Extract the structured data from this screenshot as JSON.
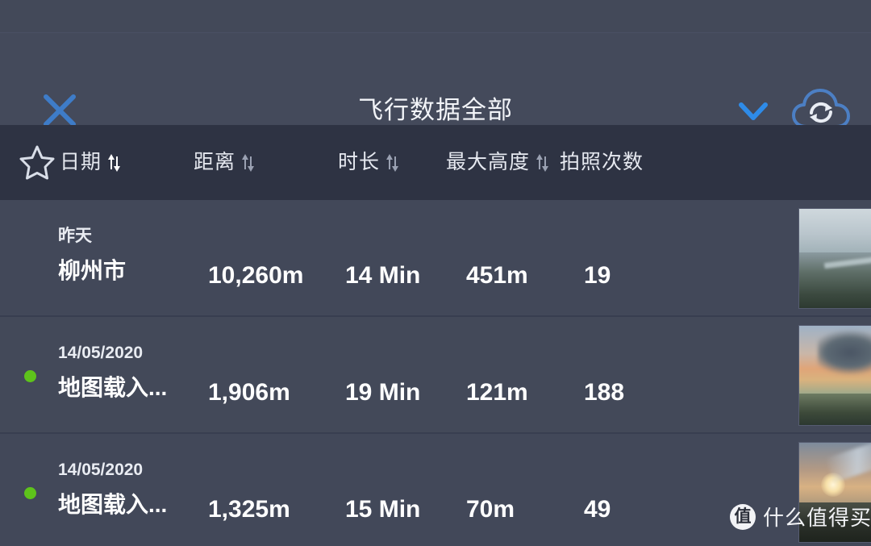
{
  "header": {
    "title": "飞行数据全部",
    "close_icon": "close-x-icon",
    "chevron_icon": "chevron-down-icon",
    "cloud_sync_icon": "cloud-sync-icon"
  },
  "columns": {
    "favorite_icon": "star-outline-icon",
    "items": [
      {
        "label": "日期",
        "sort_icon": "sort-updown-icon",
        "active": true
      },
      {
        "label": "距离",
        "sort_icon": "sort-updown-icon",
        "active": false
      },
      {
        "label": "时长",
        "sort_icon": "sort-updown-icon",
        "active": false
      },
      {
        "label": "最大高度",
        "sort_icon": "sort-updown-icon",
        "active": false
      },
      {
        "label": "拍照次数",
        "sort_icon": "",
        "active": false
      }
    ]
  },
  "rows": [
    {
      "date": "昨天",
      "location": "柳州市",
      "distance": "10,260m",
      "duration": "14 Min",
      "max_altitude": "451m",
      "photos": "19",
      "synced": false,
      "thumbnail": "aerial-city-haze-thumbnail"
    },
    {
      "date": "14/05/2020",
      "location": "地图载入...",
      "distance": "1,906m",
      "duration": "19 Min",
      "max_altitude": "121m",
      "photos": "188",
      "synced": true,
      "thumbnail": "aerial-sunset-clouds-thumbnail"
    },
    {
      "date": "14/05/2020",
      "location": "地图载入...",
      "distance": "1,325m",
      "duration": "15 Min",
      "max_altitude": "70m",
      "photos": "49",
      "synced": true,
      "thumbnail": "aerial-sunrise-thumbnail"
    }
  ],
  "watermark": {
    "logo": "值",
    "text": "什么值得买"
  },
  "colors": {
    "background": "#424859",
    "titlebar": "#444A5B",
    "column_header": "#2E3343",
    "accent_blue": "#3A7BD5",
    "sync_dot_green": "#5EC31B",
    "text_primary": "#FFFFFF"
  }
}
